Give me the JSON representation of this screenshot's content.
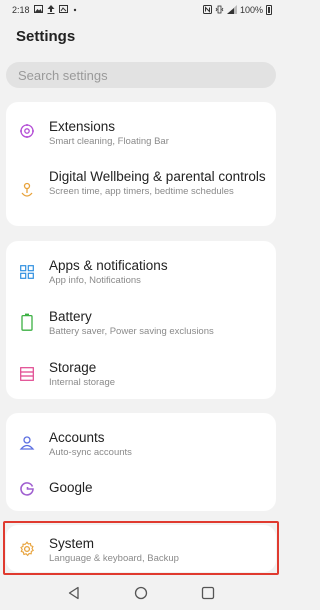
{
  "status_bar": {
    "time": "2:18",
    "battery": "100%"
  },
  "header": {
    "title": "Settings"
  },
  "search": {
    "placeholder": "Search settings"
  },
  "groups": [
    {
      "items": [
        {
          "label": "Extensions",
          "subtitle": "Smart cleaning, Floating Bar",
          "icon": "extensions-icon"
        },
        {
          "label": "Digital Wellbeing & parental controls",
          "subtitle": "Screen time, app timers, bedtime schedules",
          "icon": "digital-wellbeing-icon"
        }
      ]
    },
    {
      "items": [
        {
          "label": "Apps & notifications",
          "subtitle": "App info, Notifications",
          "icon": "apps-grid-icon"
        },
        {
          "label": "Battery",
          "subtitle": "Battery saver, Power saving exclusions",
          "icon": "battery-icon"
        },
        {
          "label": "Storage",
          "subtitle": "Internal storage",
          "icon": "storage-icon"
        }
      ]
    },
    {
      "items": [
        {
          "label": "Accounts",
          "subtitle": "Auto-sync accounts",
          "icon": "accounts-icon"
        },
        {
          "label": "Google",
          "subtitle": "",
          "icon": "google-icon"
        }
      ]
    },
    {
      "items": [
        {
          "label": "System",
          "subtitle": "Language & keyboard, Backup",
          "icon": "system-gear-icon"
        }
      ]
    }
  ],
  "colors": {
    "extensions": "#b44fd6",
    "wellbeing": "#e8a23a",
    "apps": "#2f8fe0",
    "battery": "#3cb043",
    "storage": "#e0458e",
    "accounts": "#5b6ee1",
    "google": "#a060d0",
    "system": "#e8a23a",
    "highlight": "#e03a2f"
  }
}
